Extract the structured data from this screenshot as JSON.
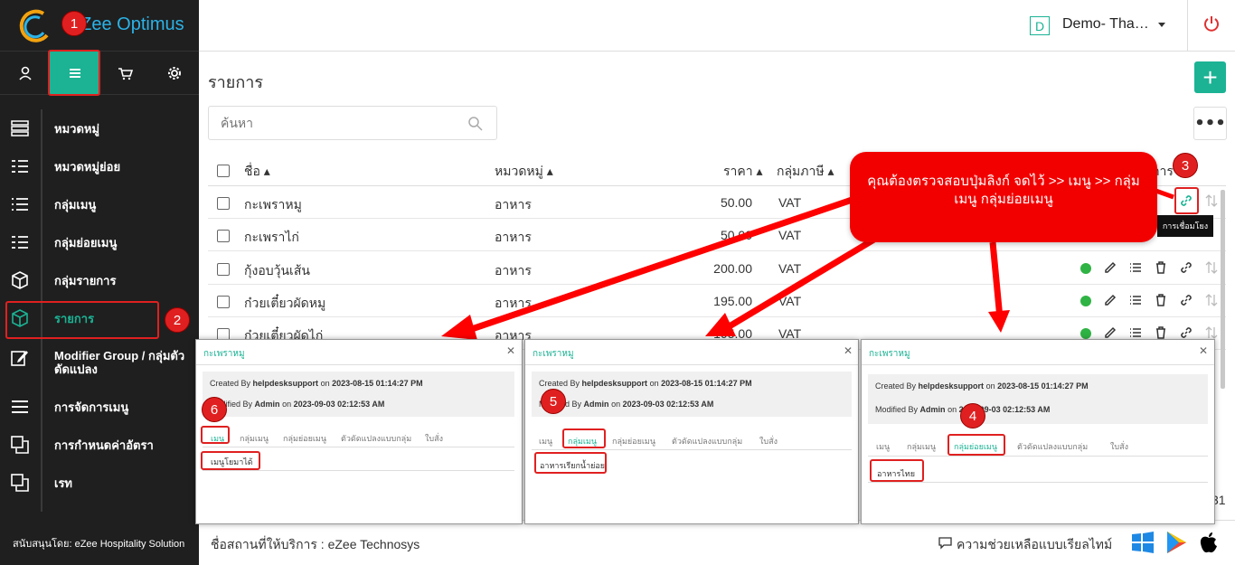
{
  "brand": {
    "logo_text": "eZee Optimus"
  },
  "sidebar": {
    "tabs": [
      "profile-icon",
      "menu-icon",
      "cart-icon",
      "gear-icon"
    ],
    "items": [
      {
        "label": "หมวดหมู่",
        "icon": "category-list-icon"
      },
      {
        "label": "หมวดหมู่ย่อย",
        "icon": "subcategory-icon"
      },
      {
        "label": "กลุ่มเมนู",
        "icon": "list-icon"
      },
      {
        "label": "กลุ่มย่อยเมนู",
        "icon": "sublist-icon"
      },
      {
        "label": "กลุ่มรายการ",
        "icon": "box-icon"
      },
      {
        "label": "รายการ",
        "icon": "box-icon"
      },
      {
        "label": "Modifier Group / กลุ่มตัวดัดแปลง",
        "icon": "edit-icon"
      },
      {
        "label": "การจัดการเมนู",
        "icon": "menu-icon"
      },
      {
        "label": "การกำหนดค่าอัตรา",
        "icon": "copy-icon"
      },
      {
        "label": "เรท",
        "icon": "copy-icon"
      }
    ],
    "powered_by": "สนับสนุนโดย: eZee Hospitality Solution"
  },
  "topbar": {
    "property_badge": "D",
    "property_name": "Demo- Tha…"
  },
  "page": {
    "title": "รายการ",
    "add_label": "+",
    "search_placeholder": "ค้นหา",
    "more_label": "•••"
  },
  "table": {
    "headers": {
      "name": "ชื่อ ▴",
      "category": "หมวดหมู่ ▴",
      "price": "ราคา ▴",
      "tax": "กลุ่มภาษี ▴",
      "actions": "การ"
    },
    "rows": [
      {
        "name": "กะเพราหมู",
        "category": "อาหาร",
        "price": "50.00",
        "tax": "VAT"
      },
      {
        "name": "กะเพราไก่",
        "category": "อาหาร",
        "price": "50.00",
        "tax": "VAT"
      },
      {
        "name": "กุ้งอบวุ้นเส้น",
        "category": "อาหาร",
        "price": "200.00",
        "tax": "VAT"
      },
      {
        "name": "ก๋วยเตี๋ยวผัดหมู",
        "category": "อาหาร",
        "price": "195.00",
        "tax": "VAT"
      },
      {
        "name": "ก๋วยเตี๋ยวผัดไก่",
        "category": "อาหาร",
        "price": "195.00",
        "tax": "VAT"
      }
    ],
    "page_stub": "31"
  },
  "tooltip": "การเชื่อมโยง",
  "callout": "คุณต้องตรวจสอบปุ่มลิงก์ จดไว้ >> เมนู >> กลุ่มเมนู กลุ่มย่อยเมนู",
  "badges": [
    "1",
    "2",
    "3",
    "4",
    "5",
    "6"
  ],
  "panels": [
    {
      "title": "กะเพราหมู",
      "created": {
        "prefix": "Created By",
        "user": "helpdesksupport",
        "on": "on",
        "date": "2023-08-15 01:14:27 PM"
      },
      "modified": {
        "prefix": "Modified By",
        "user": "Admin",
        "on": "on",
        "date": "2023-09-03 02:12:53 AM"
      },
      "tabs": [
        "เมนู",
        "กลุ่มเมนู",
        "กลุ่มย่อยเมนู",
        "ตัวดัดแปลงแบบกลุ่ม",
        "ใบสั่ง"
      ],
      "active_tab": 0,
      "value": "เมนูโยมาได้"
    },
    {
      "title": "กะเพราหมู",
      "created": {
        "prefix": "Created By",
        "user": "helpdesksupport",
        "on": "on",
        "date": "2023-08-15 01:14:27 PM"
      },
      "modified": {
        "prefix": "Modified By",
        "user": "Admin",
        "on": "on",
        "date": "2023-09-03 02:12:53 AM"
      },
      "tabs": [
        "เมนู",
        "กลุ่มเมนู",
        "กลุ่มย่อยเมนู",
        "ตัวดัดแปลงแบบกลุ่ม",
        "ใบสั่ง"
      ],
      "active_tab": 1,
      "value": "อาหารเรียกน้ำย่อย"
    },
    {
      "title": "กะเพราหมู",
      "created": {
        "prefix": "Created By",
        "user": "helpdesksupport",
        "on": "on",
        "date": "2023-08-15 01:14:27 PM"
      },
      "modified": {
        "prefix": "Modified By",
        "user": "Admin",
        "on": "on",
        "date": "2023-09-03 02:12:53 AM"
      },
      "tabs": [
        "เมนู",
        "กลุ่มเมนู",
        "กลุ่มย่อยเมนู",
        "ตัวดัดแปลงแบบกลุ่ม",
        "ใบสั่ง"
      ],
      "active_tab": 2,
      "value": "อาหารไทย"
    }
  ],
  "footer": {
    "provider": "ชื่อสถานที่ให้บริการ : eZee Technosys",
    "help": "ความช่วยเหลือแบบเรียลไทม์",
    "stores": [
      "windows-icon",
      "google-play-icon",
      "apple-icon"
    ]
  },
  "colors": {
    "accent": "#1bb394",
    "annotation": "#e02020",
    "sidebar_bg": "#1f1f1f"
  }
}
